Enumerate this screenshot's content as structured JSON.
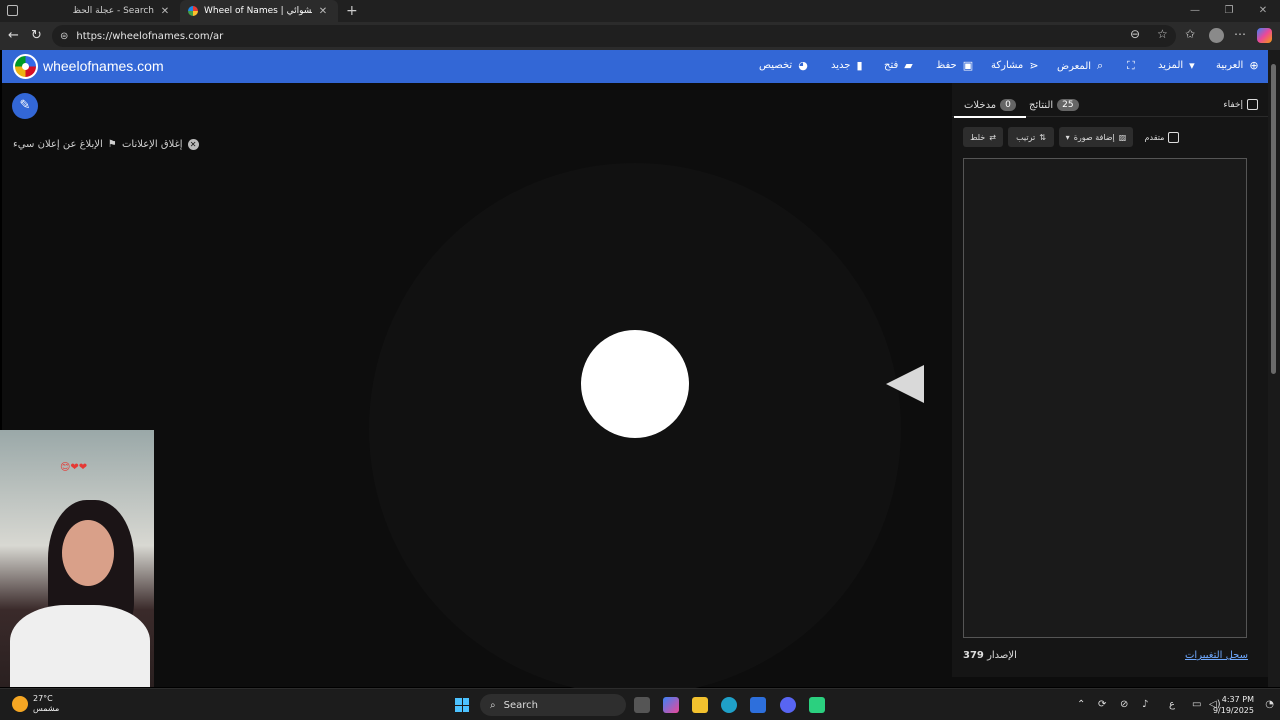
{
  "browser": {
    "tabs": [
      {
        "title": "عجلة الحظ - Search",
        "active": false
      },
      {
        "title": "Wheel of Names | الاسم العشوائي",
        "active": true
      }
    ],
    "new_tab": "+",
    "url": "https://wheelofnames.com/ar"
  },
  "header": {
    "site_title": "wheelofnames.com",
    "menu": [
      {
        "label": "تخصيص",
        "icon": "palette-icon"
      },
      {
        "label": "جديد",
        "icon": "new-file-icon"
      },
      {
        "label": "فتح",
        "icon": "folder-icon"
      },
      {
        "label": "حفظ",
        "icon": "save-icon"
      },
      {
        "label": "مشاركة",
        "icon": "share-icon"
      },
      {
        "label": "المعرض",
        "icon": "search-icon"
      },
      {
        "label": "",
        "icon": "fullscreen-icon"
      },
      {
        "label": "المزيد",
        "icon": "chevron-down-icon"
      },
      {
        "label": "العربية",
        "icon": "globe-icon"
      }
    ]
  },
  "main": {
    "close_ads": "إغلاق الإعلانات",
    "report_ad": "الإبلاغ عن إعلان سيء"
  },
  "panel": {
    "tab_entries": {
      "label": "مدخلات",
      "count": "0"
    },
    "tab_results": {
      "label": "النتائج",
      "count": "25"
    },
    "hide_label": "إخفاء",
    "shuffle_label": "خلط",
    "sort_label": "ترتيب",
    "add_image_label": "إضافة صورة",
    "advanced_label": "متقدم",
    "version_label": "الإصدار",
    "version_number": "379",
    "changelog": "سجل التغييرات"
  },
  "taskbar": {
    "weather_temp": "27°C",
    "weather_desc": "مشمس",
    "search_label": "Search",
    "lang": "ع",
    "time": "4:37 PM",
    "date": "9/19/2025"
  }
}
